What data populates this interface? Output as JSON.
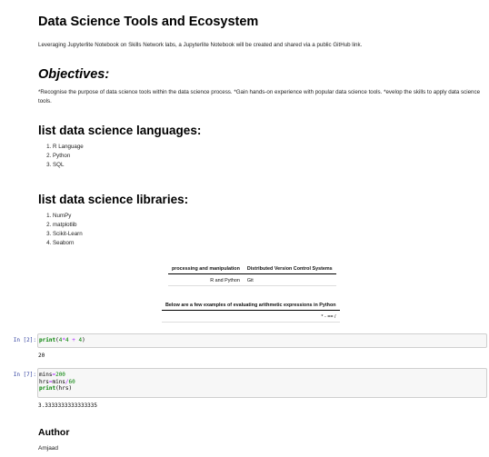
{
  "title": "Data Science Tools and Ecosystem",
  "intro": "Leveraging Jupyterlite Notebook on Skills Network labs, a Jupyterlite Notebook will be created and shared via a public GitHub link.",
  "objectives": {
    "heading": "Objectives:",
    "text": "*Recognise the purpose of data science tools within the data science process. *Gain hands-on experience with popular data science tools. *evelop the skills to apply data science tools."
  },
  "languages": {
    "heading": "list data science languages:",
    "items": [
      "R Language",
      "Python",
      "SQL"
    ]
  },
  "libraries": {
    "heading": "list data science libraries:",
    "items": [
      "NumPy",
      "matplotlib",
      "Scikit-Learn",
      "Seaborn"
    ]
  },
  "tools_table": {
    "headers": [
      "processing and manipulation",
      "Distributed Version Control Systems"
    ],
    "row": [
      "R and Python",
      "Git"
    ]
  },
  "expr_table": {
    "header": "Below are a few examples of evaluating arithmetic expressions in Python",
    "row": "* - == /"
  },
  "cells": [
    {
      "prompt": "In [2]:",
      "code": [
        "print(4*4 + 4)"
      ],
      "output": "20"
    },
    {
      "prompt": "In [7]:",
      "code": [
        "mins=200",
        "hrs=mins/60",
        "print(hrs)"
      ],
      "output": "3.3333333333333335"
    }
  ],
  "author": {
    "heading": "Author",
    "name": "Amjaad"
  },
  "colors": {
    "prompt": "#303f9f",
    "cell_bg": "#f7f7f7",
    "cell_border": "#cfcfcf"
  }
}
